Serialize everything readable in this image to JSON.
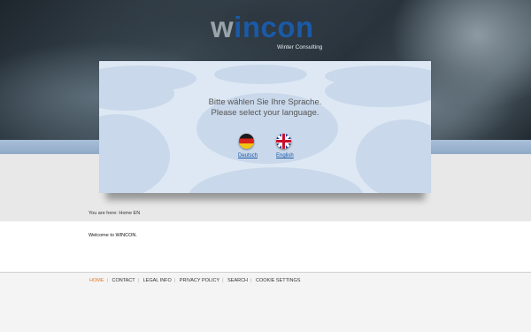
{
  "logo": {
    "part1": "w",
    "part2": "incon",
    "subtitle": "Winter Consulting"
  },
  "language_dialog": {
    "prompt_de": "Bitte wählen Sie Ihre Sprache.",
    "prompt_en": "Please select your language.",
    "options": [
      {
        "label": "Deutsch",
        "icon": "german-flag-icon"
      },
      {
        "label": "English",
        "icon": "uk-flag-icon"
      }
    ]
  },
  "breadcrumb": "You are here: Home EN",
  "main": {
    "welcome": "Welcome to WINCON."
  },
  "footer_nav": {
    "items": [
      "HOME",
      "CONTACT",
      "LEGAL INFO",
      "PRIVACY POLICY",
      "SEARCH",
      "COOKIE SETTINGS"
    ],
    "active": "HOME",
    "separator": "|"
  },
  "colors": {
    "accent": "#1a5aa6",
    "active_nav": "#e07a2a",
    "link": "#1a58a8"
  }
}
